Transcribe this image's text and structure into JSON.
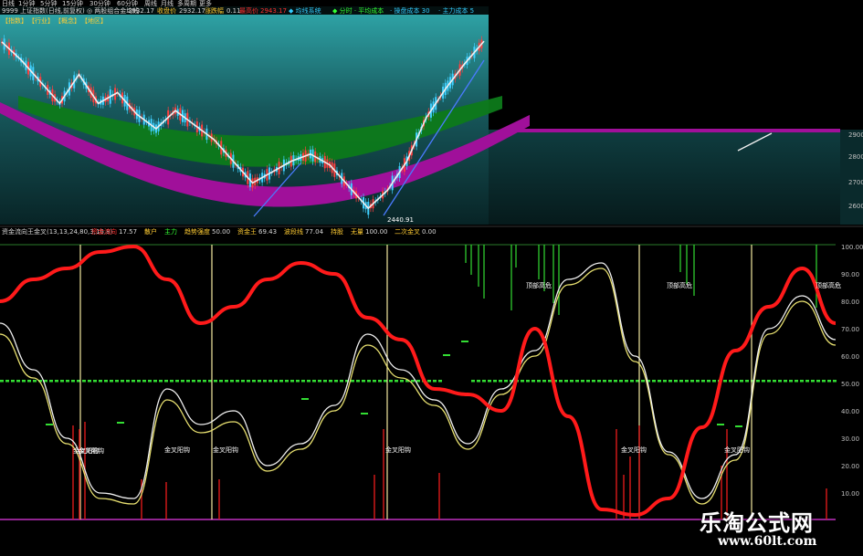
{
  "toolbar": {
    "periods": [
      "日线",
      "1分钟",
      "5分钟",
      "15分钟",
      "30分钟",
      "60分钟",
      "周线",
      "月线",
      "多周期",
      "更多"
    ]
  },
  "upper_panel": {
    "title_left": "9999 上证指数(日线,前复权) ◎ 两股组合金均线",
    "title_left_value": "2932.17",
    "legend_mid_label": "收盘价",
    "legend_mid_value": "2932.17",
    "legend_pct_label": "涨跌幅",
    "legend_pct_value": "0.11",
    "legend_red_label": "最高价",
    "legend_red_value": "2943.17",
    "right_title": "◆ 均线系统",
    "right_items": [
      "◆ 分时 · 平均成本",
      "· 操盘成本 30",
      "· 主力成本 5"
    ],
    "tabs": [
      "【指数】",
      "【行业】",
      "【概念】",
      "【地区】"
    ],
    "low_label": "2440.91",
    "y_ticks": [
      "2900",
      "2800",
      "2700",
      "2600",
      "2500"
    ]
  },
  "lower_panel": {
    "title": "资金流向王金叉(13,13,24,80,3,16,8)",
    "legend": [
      {
        "label": "资金流向",
        "value": "17.57"
      },
      {
        "label": "散户",
        "value": ""
      },
      {
        "label": "主力",
        "value": ""
      },
      {
        "label": "趋势强度",
        "value": "50.00"
      },
      {
        "label": "资金王",
        "value": "69.43"
      },
      {
        "label": "波段线",
        "value": "77.04"
      },
      {
        "label": "持股",
        "value": ""
      },
      {
        "label": "无量",
        "value": "100.00"
      },
      {
        "label": "二次金叉",
        "value": "0.00"
      }
    ],
    "y_ticks": [
      "100.00",
      "90.00",
      "80.00",
      "70.00",
      "60.00",
      "50.00",
      "40.00",
      "30.00",
      "20.00",
      "10.00"
    ],
    "annotations": [
      "金叉阳钩",
      "金叉阳钩",
      "金叉阳钩",
      "金叉阳钩",
      "金叉阳钩",
      "金叉阳钩",
      "金叉阳钩",
      "顶部高危",
      "顶部高危",
      "顶部高危"
    ]
  },
  "watermark": {
    "site_name": "乐淘公式网",
    "url": "www.60lt.com"
  },
  "colors": {
    "background": "#000000",
    "cloud_green": "#0d7a1a",
    "cloud_magenta": "#a0109a",
    "main_red": "#ff1a1a",
    "white_line": "#f0f0f0",
    "yellow_line": "#e8e070",
    "green_bars": "#33dd33",
    "accent_yellow": "#ffcc33"
  },
  "chart_data": [
    {
      "type": "line",
      "title": "9999 上证指数(日线,前复权) ◎ 两股组合金均线",
      "xlabel": "",
      "ylabel": "",
      "ylim": [
        2440,
        2950
      ],
      "x": [
        0,
        10,
        20,
        30,
        40,
        50,
        60,
        70,
        80,
        90,
        100,
        110,
        120,
        130,
        140,
        150,
        160,
        170,
        180,
        190,
        200,
        210,
        220,
        230,
        240,
        250
      ],
      "series": [
        {
          "values": [
            2930,
            2880,
            2820,
            2760,
            2840,
            2760,
            2790,
            2730,
            2690,
            2740,
            2700,
            2660,
            2600,
            2540,
            2570,
            2600,
            2620,
            2590,
            2530,
            2470,
            2520,
            2600,
            2720,
            2800,
            2870,
            2932
          ]
        }
      ]
    },
    {
      "type": "line",
      "title": "资金流向王金叉(13,13,24,80,3,16,8)",
      "xlabel": "",
      "ylabel": "",
      "ylim": [
        0,
        100
      ],
      "x": [
        0,
        10,
        20,
        30,
        40,
        50,
        60,
        70,
        80,
        90,
        100,
        110,
        120,
        130,
        140,
        150,
        160,
        170,
        180,
        190,
        200,
        210,
        220,
        230,
        240,
        250
      ],
      "series": [
        {
          "name": "资金流向",
          "values": [
            80,
            88,
            92,
            98,
            100,
            88,
            72,
            78,
            88,
            94,
            90,
            74,
            66,
            48,
            46,
            40,
            70,
            38,
            4,
            2,
            8,
            34,
            62,
            78,
            92,
            72
          ]
        },
        {
          "name": "资金王",
          "values": [
            72,
            55,
            30,
            10,
            8,
            48,
            35,
            40,
            20,
            28,
            42,
            68,
            55,
            44,
            28,
            48,
            62,
            88,
            94,
            60,
            25,
            8,
            24,
            70,
            82,
            66
          ]
        },
        {
          "name": "波段线",
          "values": [
            68,
            52,
            28,
            8,
            6,
            44,
            32,
            36,
            18,
            26,
            40,
            64,
            52,
            42,
            26,
            46,
            60,
            86,
            92,
            58,
            24,
            6,
            22,
            68,
            80,
            64
          ]
        }
      ]
    }
  ]
}
